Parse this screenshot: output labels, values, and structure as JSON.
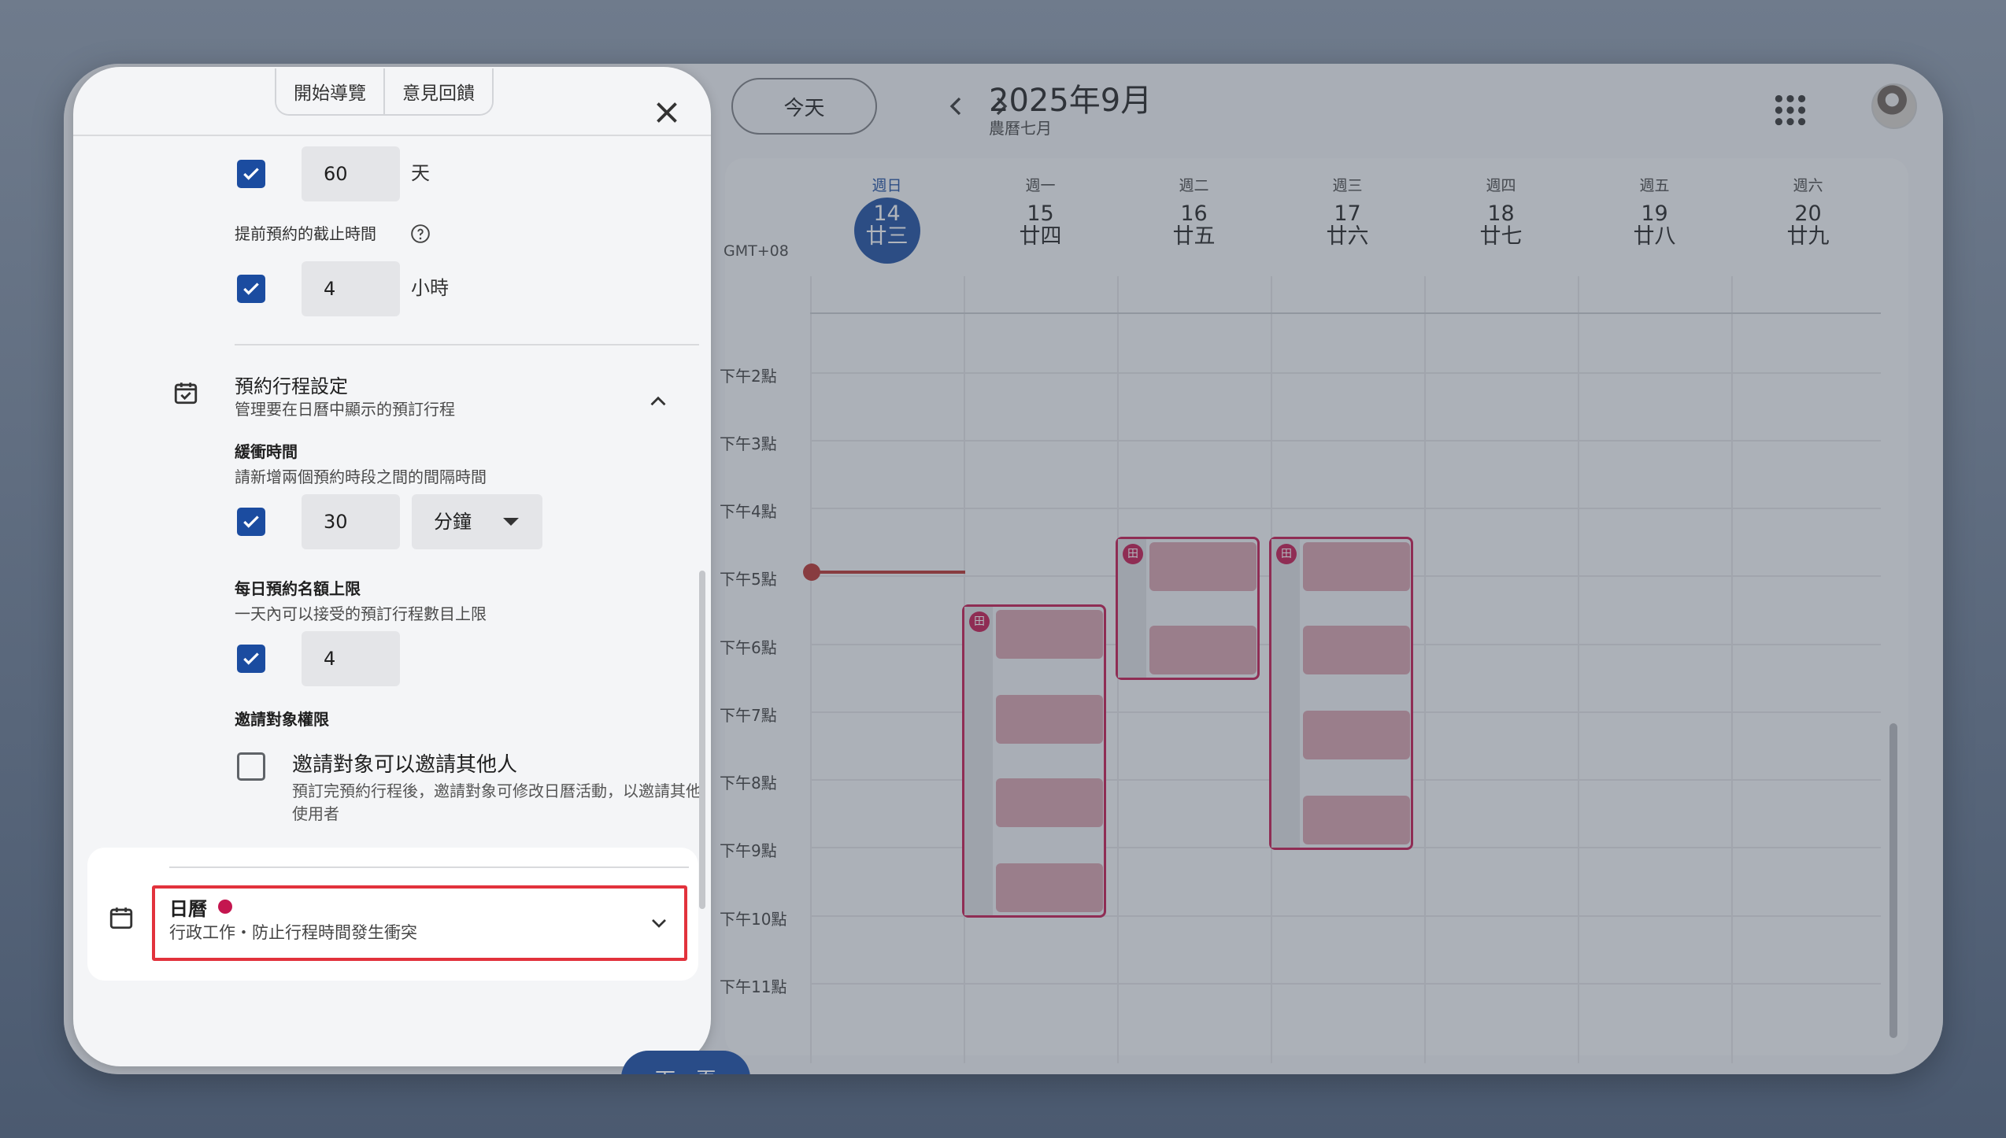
{
  "calendar": {
    "today_label": "今天",
    "month_title": "2025年9月",
    "lunar_month": "農曆七月",
    "timezone": "GMT+08",
    "days": [
      {
        "weekday": "週日",
        "date": "14",
        "lunar": "廿三",
        "today": true
      },
      {
        "weekday": "週一",
        "date": "15",
        "lunar": "廿四"
      },
      {
        "weekday": "週二",
        "date": "16",
        "lunar": "廿五"
      },
      {
        "weekday": "週三",
        "date": "17",
        "lunar": "廿六"
      },
      {
        "weekday": "週四",
        "date": "18",
        "lunar": "廿七"
      },
      {
        "weekday": "週五",
        "date": "19",
        "lunar": "廿八"
      },
      {
        "weekday": "週六",
        "date": "20",
        "lunar": "廿九"
      }
    ],
    "hours": [
      "下午2點",
      "下午3點",
      "下午4點",
      "下午5點",
      "下午6點",
      "下午7點",
      "下午8點",
      "下午9點",
      "下午10點",
      "下午11點"
    ],
    "event_color": "#c4164f",
    "today_color": "#1b4ca0"
  },
  "panel": {
    "tour_label": "開始導覽",
    "feedback_label": "意見回饋",
    "days_value": "60",
    "days_unit": "天",
    "cutoff_label": "提前預約的截止時間",
    "cutoff_value": "4",
    "cutoff_unit": "小時",
    "booking_title": "預約行程設定",
    "booking_desc": "管理要在日曆中顯示的預訂行程",
    "buffer_label": "緩衝時間",
    "buffer_desc": "請新增兩個預約時段之間的間隔時間",
    "buffer_value": "30",
    "buffer_unit": "分鐘",
    "daily_max_label": "每日預約名額上限",
    "daily_max_desc": "一天內可以接受的預訂行程數目上限",
    "daily_max_value": "4",
    "guest_perm_label": "邀請對象權限",
    "invite_title": "邀請對象可以邀請其他人",
    "invite_desc": "預訂完預約行程後，邀請對象可修改日曆活動，以邀請其他使用者",
    "calendar_title": "日曆",
    "calendar_sub": "行政工作・防止行程時間發生衝突",
    "next_label": "下一頁"
  }
}
